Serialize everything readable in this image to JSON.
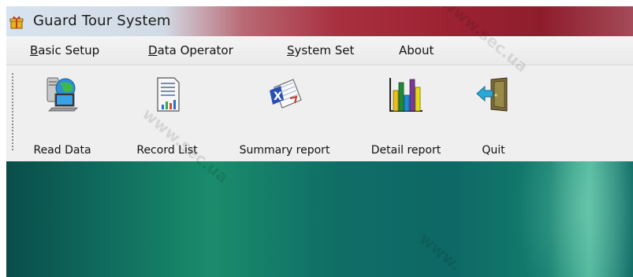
{
  "window": {
    "title": "Guard Tour System",
    "app_icon": "gift-icon"
  },
  "menu": {
    "items": [
      {
        "accel": "B",
        "rest": "asic Setup"
      },
      {
        "accel": "D",
        "rest": "ata Operator"
      },
      {
        "accel": "S",
        "rest": "ystem Set"
      },
      {
        "accel": "",
        "rest": "About"
      }
    ]
  },
  "toolbar": {
    "buttons": [
      {
        "label": "Read Data",
        "icon": "computer-globe-icon"
      },
      {
        "label": "Record List",
        "icon": "document-chart-icon"
      },
      {
        "label": "Summary report",
        "icon": "excel-sheet-icon"
      },
      {
        "label": "Detail  report",
        "icon": "bar-chart-icon"
      },
      {
        "label": "Quit",
        "icon": "exit-door-icon"
      }
    ]
  },
  "watermark": {
    "text_a": "www.sec.ua",
    "text_b": "www.sec.ua",
    "text_c": "www."
  },
  "colors": {
    "title_bar_accent": "#9c2232",
    "desktop": "#0f6a5d",
    "menu_bg": "#eeeeee"
  }
}
